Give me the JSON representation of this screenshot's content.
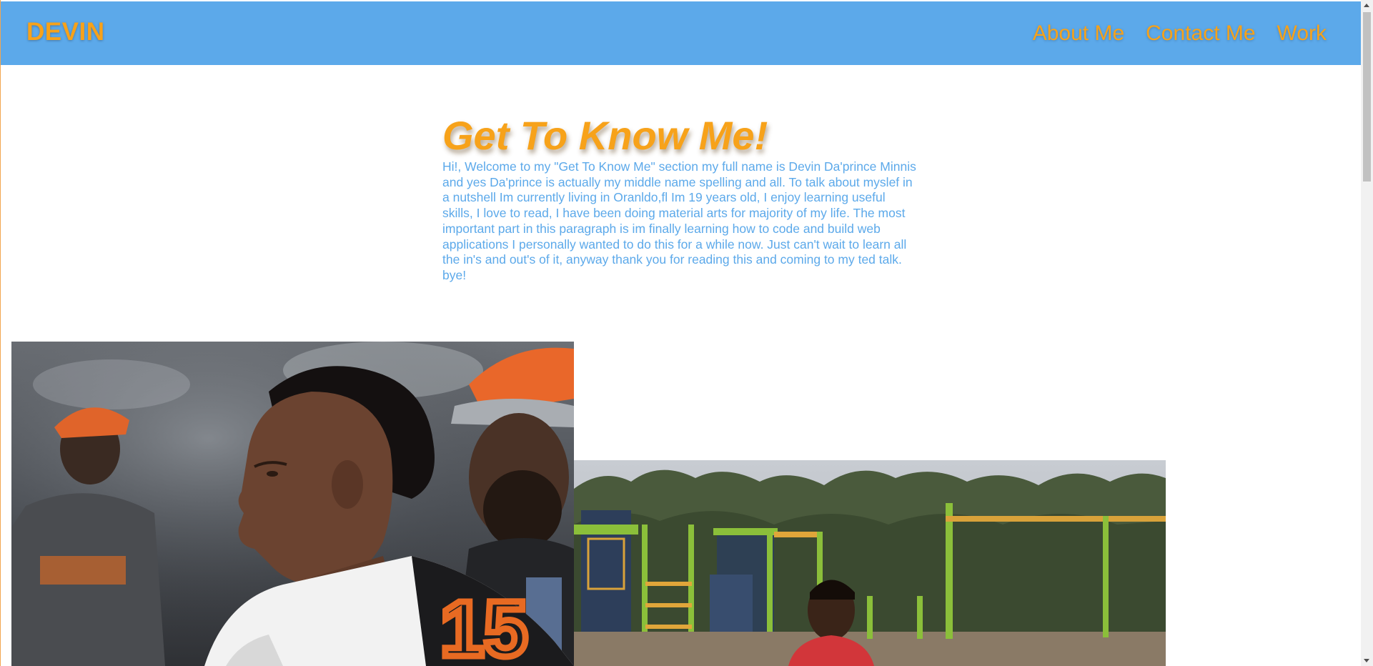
{
  "navbar": {
    "brand": "DEVIN",
    "links": [
      {
        "label": "About Me"
      },
      {
        "label": "Contact Me"
      },
      {
        "label": "Work"
      }
    ]
  },
  "about": {
    "heading": "Get To Know Me!",
    "paragraph": "Hi!, Welcome to my \"Get To Know Me\" section my full name is Devin Da'prince Minnis and yes Da'prince is actually my middle name spelling and all. To talk about myslef in a nutshell Im currently living in Oranldo,fl Im 19 years old, I enjoy learning useful skills, I love to read, I have been doing material arts for majority of my life. The most important part in this paragraph is im finally learning how to code and build web applications I personally wanted to do this for a while now. Just can't wait to learn all the in's and out's of it, anyway thank you for reading this and coming to my ted talk. bye!"
  },
  "photos": {
    "football": {
      "jersey_number": "15"
    }
  },
  "colors": {
    "navbar_bg": "#5ca9ea",
    "accent_orange": "#f7a21a",
    "text_blue": "#5ca9ea"
  }
}
